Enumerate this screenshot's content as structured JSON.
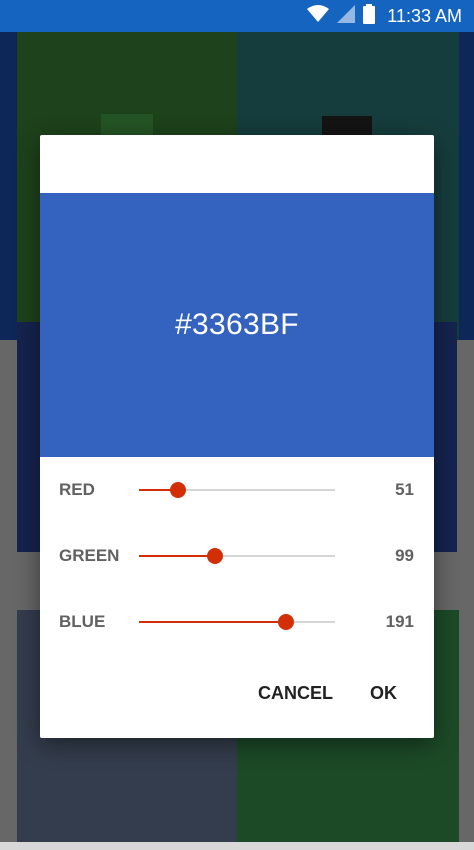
{
  "status_bar": {
    "time": "11:33 AM",
    "icons": [
      "wifi-icon",
      "cell-signal-icon",
      "battery-icon"
    ],
    "color": "#1565c0"
  },
  "dialog": {
    "hex_value": "#3363BF",
    "preview_color": "#3363BF",
    "accent_color": "#d32f06",
    "sliders": [
      {
        "label": "RED",
        "value": "51",
        "fraction": 0.2
      },
      {
        "label": "GREEN",
        "value": "99",
        "fraction": 0.388
      },
      {
        "label": "BLUE",
        "value": "191",
        "fraction": 0.749
      }
    ],
    "cancel_label": "CANCEL",
    "ok_label": "OK"
  }
}
